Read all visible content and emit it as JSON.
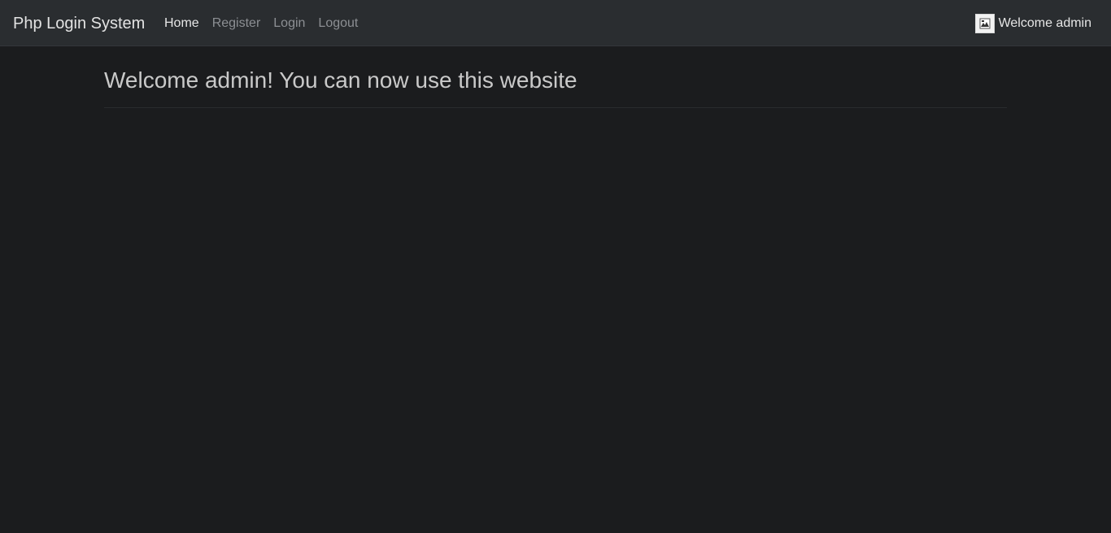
{
  "navbar": {
    "brand": "Php Login System",
    "links": [
      {
        "label": "Home",
        "active": true
      },
      {
        "label": "Register",
        "active": false
      },
      {
        "label": "Login",
        "active": false
      },
      {
        "label": "Logout",
        "active": false
      }
    ],
    "user": {
      "avatar_icon": "broken-image-icon",
      "greeting": "Welcome admin"
    }
  },
  "main": {
    "heading": "Welcome admin! You can now use this website"
  },
  "colors": {
    "page_background": "#1b1c1e",
    "navbar_background": "#2a2d30",
    "active_link": "#e6e6e6",
    "inactive_link": "#8c8f93"
  }
}
